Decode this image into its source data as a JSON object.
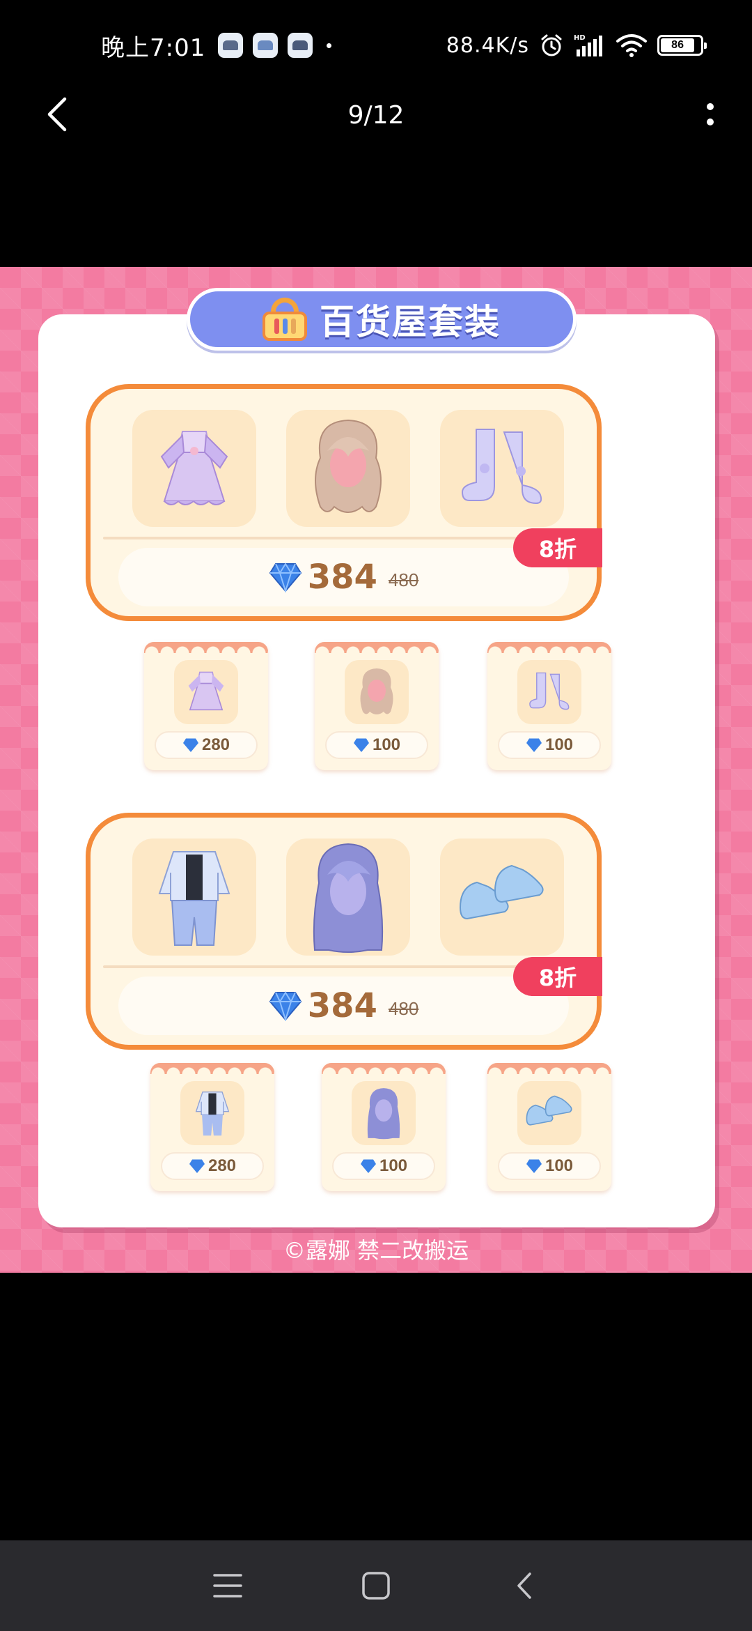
{
  "status_bar": {
    "time": "晚上7:01",
    "net_speed": "88.4K/s",
    "battery": "86",
    "icons": [
      "app-icon",
      "app-icon",
      "app-icon",
      "alarm-icon",
      "signal-icon",
      "wifi-icon",
      "battery-icon"
    ]
  },
  "nav": {
    "page_counter": "9/12",
    "back_icon": "chevron-left-icon",
    "more_icon": "more-vertical-icon"
  },
  "poster": {
    "title": "百货屋套装",
    "title_icon": "basket-icon",
    "sets": [
      {
        "items": [
          "lolita-dress-icon",
          "wavy-hair-icon",
          "bow-boots-icon"
        ],
        "price": "384",
        "original_price": "480",
        "discount": "8折",
        "singles": [
          {
            "item": "lolita-dress-icon",
            "price": "280"
          },
          {
            "item": "wavy-hair-icon",
            "price": "100"
          },
          {
            "item": "bow-boots-icon",
            "price": "100"
          }
        ]
      },
      {
        "items": [
          "jacket-outfit-icon",
          "long-purple-hair-icon",
          "sneakers-icon"
        ],
        "price": "384",
        "original_price": "480",
        "discount": "8折",
        "singles": [
          {
            "item": "jacket-outfit-icon",
            "price": "280"
          },
          {
            "item": "long-purple-hair-icon",
            "price": "100"
          },
          {
            "item": "sneakers-icon",
            "price": "100"
          }
        ]
      }
    ],
    "credit": "©露娜 禁二改搬运"
  },
  "bottom_nav": {
    "icons": [
      "menu-icon",
      "home-icon",
      "back-icon"
    ]
  },
  "colors": {
    "background_pink": "#f37ba1",
    "banner_blue": "#7e8ff0",
    "set_border_orange": "#f48b3a",
    "discount_red": "#f0405e",
    "price_brown": "#a46a3a",
    "diamond_blue": "#3b82e8"
  }
}
